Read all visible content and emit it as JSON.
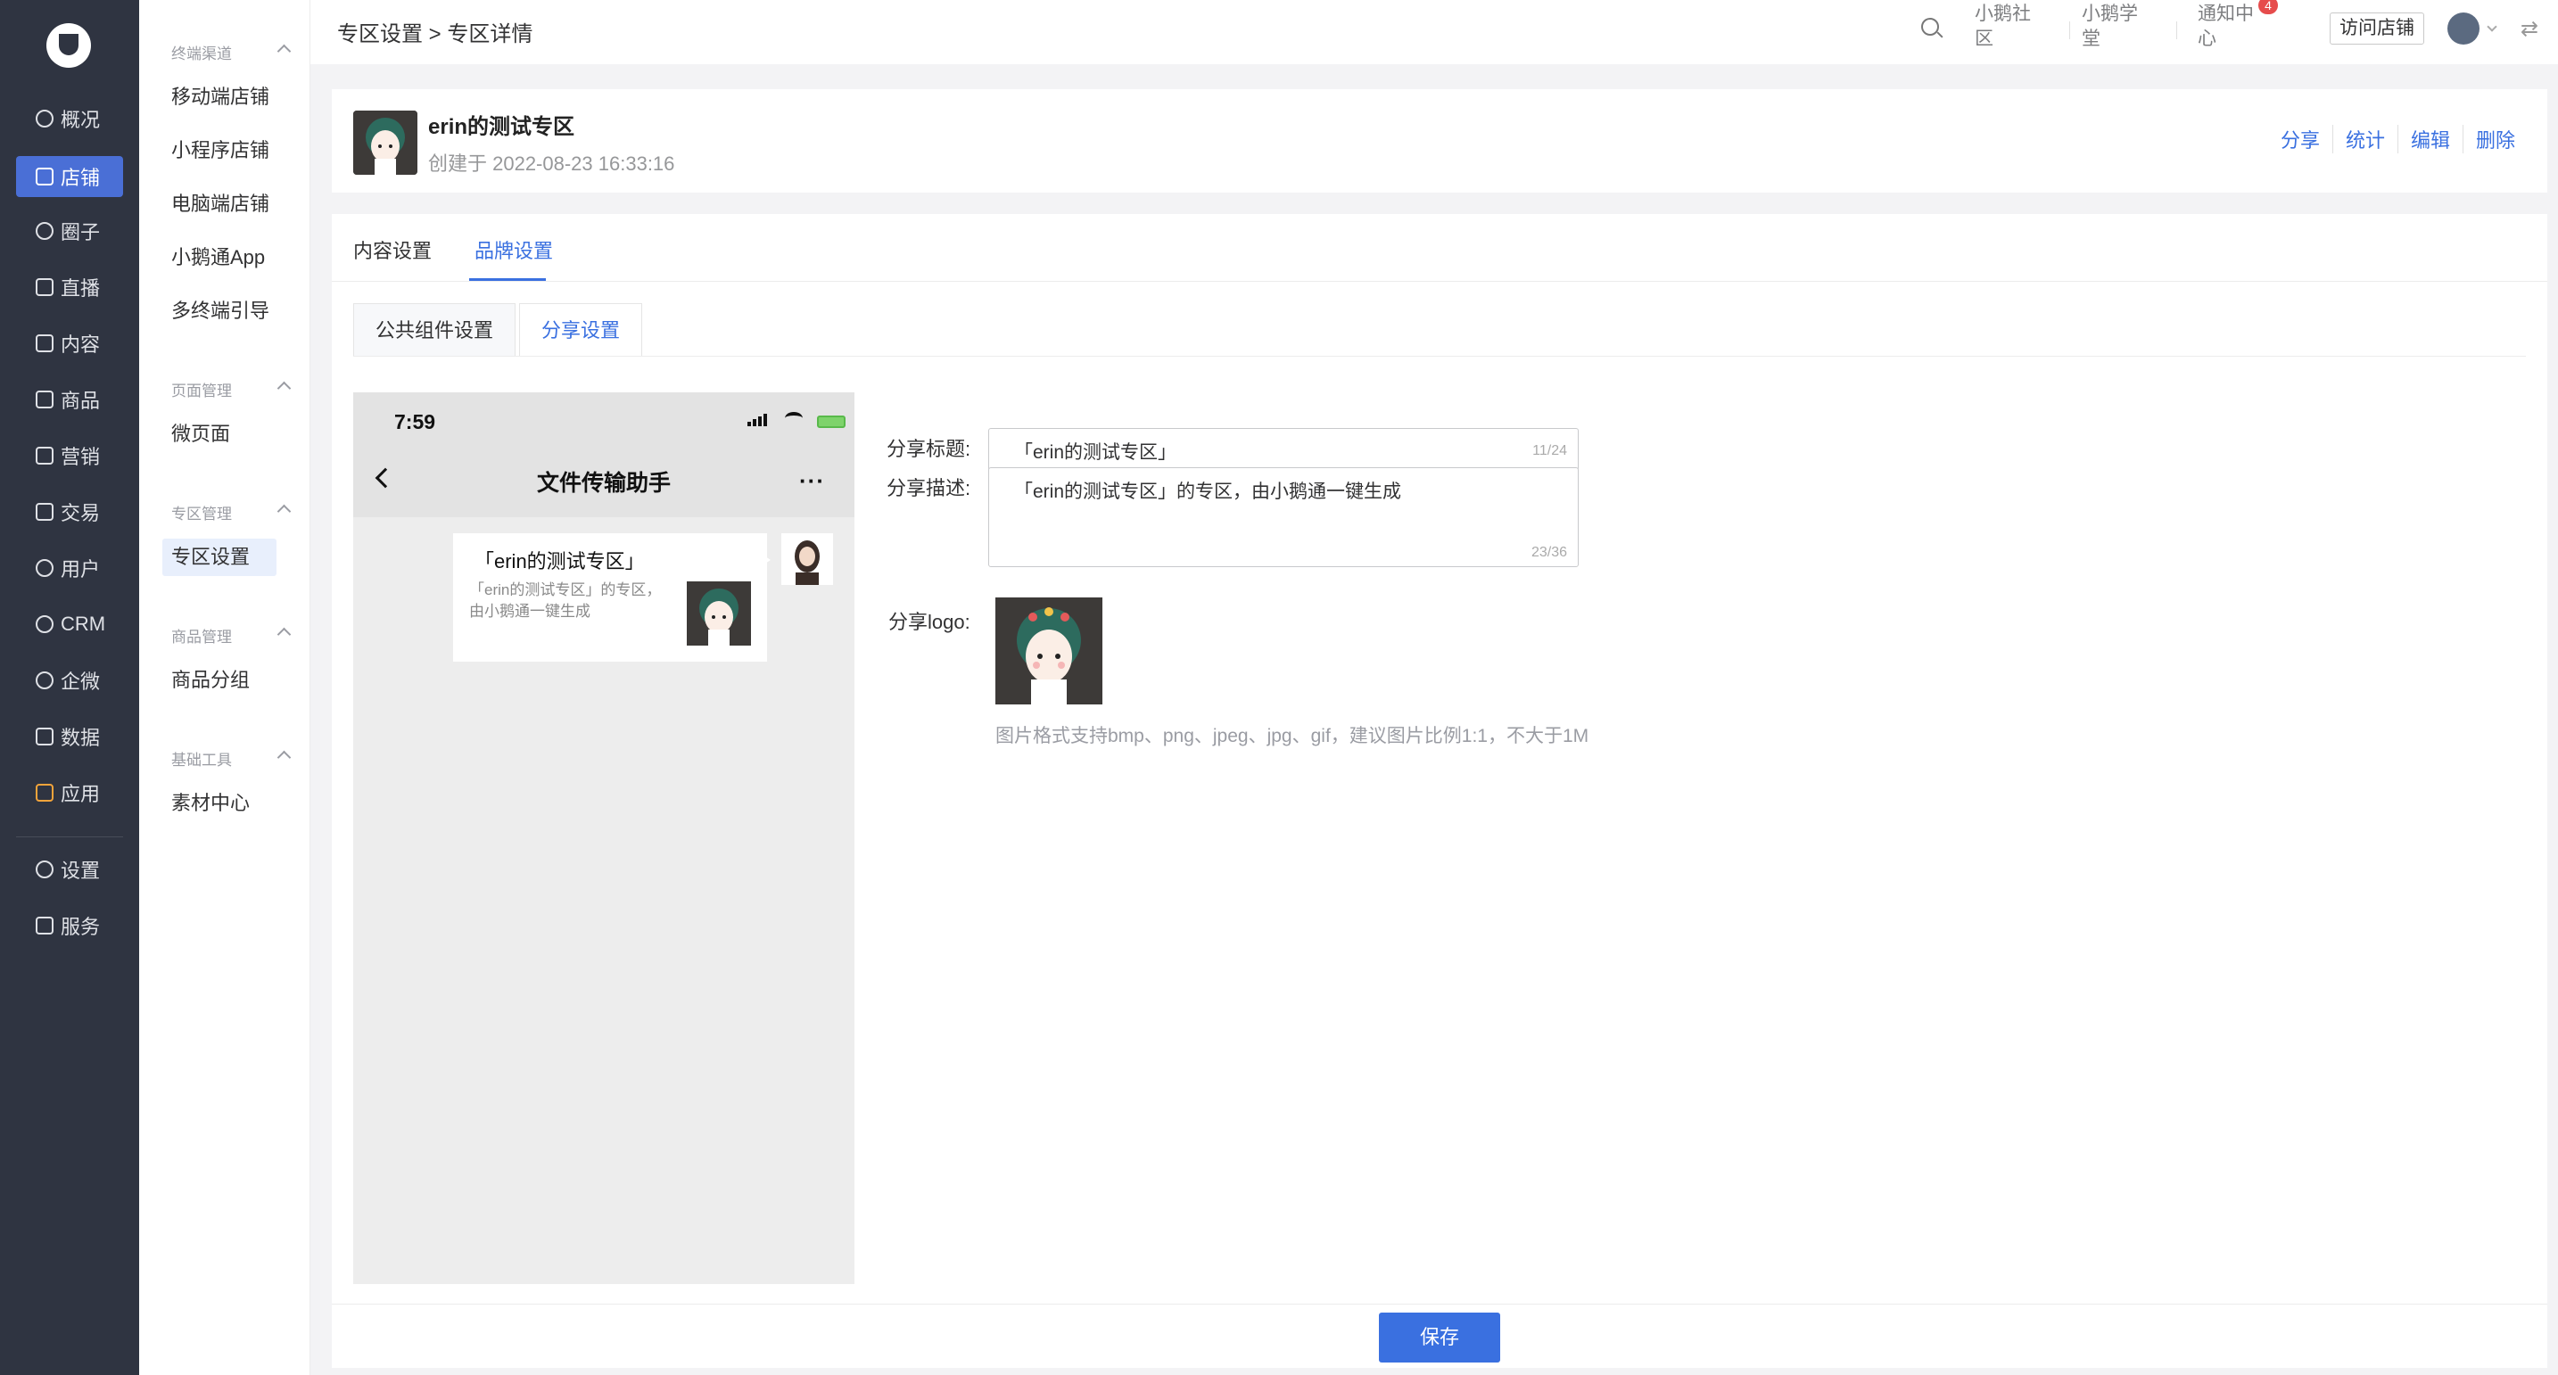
{
  "sidebar": {
    "items": [
      {
        "label": "概况",
        "icon": "dashboard-icon"
      },
      {
        "label": "店铺",
        "icon": "shop-icon"
      },
      {
        "label": "圈子",
        "icon": "circle-icon"
      },
      {
        "label": "直播",
        "icon": "live-icon"
      },
      {
        "label": "内容",
        "icon": "content-icon"
      },
      {
        "label": "商品",
        "icon": "goods-icon"
      },
      {
        "label": "营销",
        "icon": "marketing-icon"
      },
      {
        "label": "交易",
        "icon": "trade-icon"
      },
      {
        "label": "用户",
        "icon": "user-icon"
      },
      {
        "label": "CRM",
        "icon": "crm-icon"
      },
      {
        "label": "企微",
        "icon": "wecom-icon"
      },
      {
        "label": "数据",
        "icon": "data-icon"
      },
      {
        "label": "应用",
        "icon": "apps-icon"
      },
      {
        "label": "设置",
        "icon": "settings-icon"
      },
      {
        "label": "服务",
        "icon": "service-icon"
      }
    ],
    "active": "店铺"
  },
  "subnav": {
    "groups": [
      {
        "title": "终端渠道",
        "items": [
          "移动端店铺",
          "小程序店铺",
          "电脑端店铺",
          "小鹅通App",
          "多终端引导"
        ]
      },
      {
        "title": "页面管理",
        "items": [
          "微页面"
        ]
      },
      {
        "title": "专区管理",
        "items": [
          "专区设置"
        ]
      },
      {
        "title": "商品管理",
        "items": [
          "商品分组"
        ]
      },
      {
        "title": "基础工具",
        "items": [
          "素材中心"
        ]
      }
    ],
    "active": "专区设置"
  },
  "topbar": {
    "breadcrumb": "专区设置 > 专区详情",
    "links": [
      "小鹅社区",
      "小鹅学堂",
      "通知中心"
    ],
    "notification_count": "4",
    "visit_button": "访问店铺"
  },
  "zone": {
    "title": "erin的测试专区",
    "created": "创建于 2022-08-23 16:33:16",
    "actions": [
      "分享",
      "统计",
      "编辑",
      "删除"
    ]
  },
  "tabs": [
    "内容设置",
    "品牌设置"
  ],
  "active_tab": "品牌设置",
  "subtabs": [
    "公共组件设置",
    "分享设置"
  ],
  "active_subtab": "分享设置",
  "preview": {
    "time": "7:59",
    "chat_title": "文件传输助手",
    "card_title": "「erin的测试专区」",
    "card_desc": "「erin的测试专区」的专区，由小鹅通一键生成"
  },
  "share": {
    "title_label": "分享标题:",
    "title_value": "「erin的测试专区」",
    "title_count": "11/24",
    "desc_label": "分享描述:",
    "desc_value": "「erin的测试专区」的专区，由小鹅通一键生成",
    "desc_count": "23/36",
    "logo_label": "分享logo:",
    "hint": "图片格式支持bmp、png、jpeg、jpg、gif，建议图片比例1:1，不大于1M"
  },
  "save_label": "保存",
  "colors": {
    "primary": "#3a70e0",
    "sidebar_bg": "#2f3441",
    "badge": "#e64c4c"
  }
}
